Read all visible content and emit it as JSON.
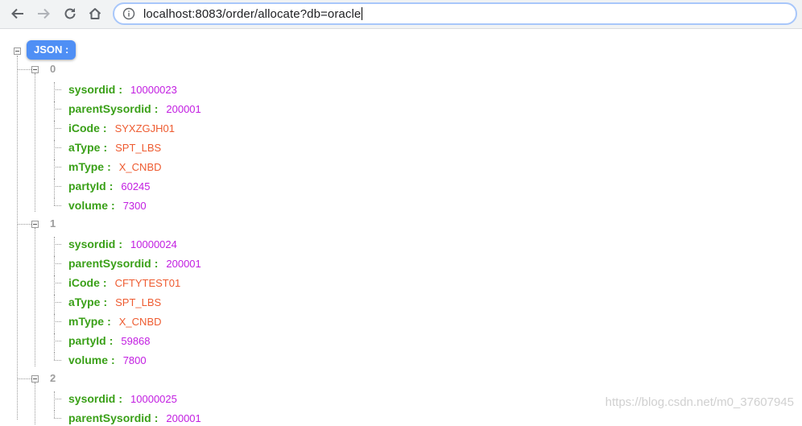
{
  "browser": {
    "url_host": "localhost",
    "url_rest": ":8083/order/allocate?db=oracle"
  },
  "json_view": {
    "root_label": "JSON :",
    "separator": ":",
    "items": [
      {
        "index": "0",
        "fields": [
          {
            "key": "sysordid",
            "value": "10000023",
            "kind": "num"
          },
          {
            "key": "parentSysordid",
            "value": "200001",
            "kind": "num"
          },
          {
            "key": "iCode",
            "value": "SYXZGJH01",
            "kind": "str"
          },
          {
            "key": "aType",
            "value": "SPT_LBS",
            "kind": "str"
          },
          {
            "key": "mType",
            "value": "X_CNBD",
            "kind": "str"
          },
          {
            "key": "partyId",
            "value": "60245",
            "kind": "num"
          },
          {
            "key": "volume",
            "value": "7300",
            "kind": "num"
          }
        ]
      },
      {
        "index": "1",
        "fields": [
          {
            "key": "sysordid",
            "value": "10000024",
            "kind": "num"
          },
          {
            "key": "parentSysordid",
            "value": "200001",
            "kind": "num"
          },
          {
            "key": "iCode",
            "value": "CFTYTEST01",
            "kind": "str"
          },
          {
            "key": "aType",
            "value": "SPT_LBS",
            "kind": "str"
          },
          {
            "key": "mType",
            "value": "X_CNBD",
            "kind": "str"
          },
          {
            "key": "partyId",
            "value": "59868",
            "kind": "num"
          },
          {
            "key": "volume",
            "value": "7800",
            "kind": "num"
          }
        ]
      },
      {
        "index": "2",
        "fields": [
          {
            "key": "sysordid",
            "value": "10000025",
            "kind": "num"
          },
          {
            "key": "parentSysordid",
            "value": "200001",
            "kind": "num"
          }
        ]
      }
    ]
  },
  "watermark": "https://blog.csdn.net/m0_37607945",
  "colors": {
    "key": "#3aa018",
    "number_value": "#c21ee1",
    "string_value": "#ee5b30",
    "index": "#9c9c9c",
    "root_badge": "#4f8ff5"
  }
}
